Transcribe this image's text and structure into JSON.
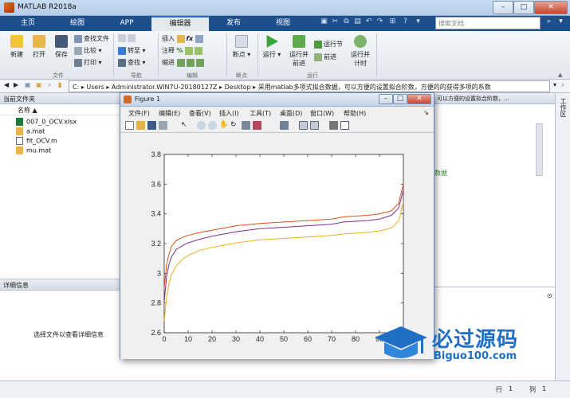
{
  "window": {
    "title": "MATLAB R2018a"
  },
  "tabs": [
    "主页",
    "绘图",
    "APP",
    "编辑器",
    "发布",
    "视图"
  ],
  "search": {
    "placeholder": "搜索文档"
  },
  "ribbon": {
    "file": {
      "new": "新建",
      "open": "打开",
      "save": "保存",
      "find_files": "查找文件",
      "compare": "比较",
      "print": "打印",
      "group": "文件"
    },
    "navigate": {
      "goto": "转至",
      "find": "查找",
      "group": "导航"
    },
    "edit": {
      "insert": "插入",
      "comment": "注释",
      "indent": "缩进",
      "group": "编辑"
    },
    "breakpoints": {
      "label": "断点",
      "group": "断点"
    },
    "run": {
      "run": "运行",
      "run_advance_1": "运行并",
      "run_advance_2": "前进",
      "run_section": "运行节",
      "advance": "前进",
      "run_time_1": "运行并",
      "run_time_2": "计时",
      "group": "运行"
    }
  },
  "address": {
    "path": "C: ▸ Users ▸ Administrator.WIN7U-20180127Z ▸ Desktop ▸ 采用matlab多项式拟合数据，可以方便的设置拟合阶数，方便的的获得多项的系数"
  },
  "current_folder": {
    "title": "当前文件夹",
    "col_name": "名称 ▲",
    "files": [
      "007_0_OCV.xlsx",
      "a.mat",
      "fit_OCV.m",
      "mu.mat"
    ]
  },
  "details": {
    "title": "详细信息",
    "message": "选择文件以查看详细信息"
  },
  "editor_fragments": {
    "tab_text": "可以方便的设置拟合阶数，...",
    "code_text": "数据"
  },
  "side_label": "工作区",
  "status": {
    "row_label": "行",
    "row_val": "1",
    "col_label": "列",
    "col_val": "1"
  },
  "figure": {
    "title": "Figure 1",
    "menu": [
      "文件(F)",
      "编辑(E)",
      "查看(V)",
      "插入(I)",
      "工具(T)",
      "桌面(D)",
      "窗口(W)",
      "帮助(H)"
    ]
  },
  "watermark": {
    "main": "必过源码",
    "sub": "Biguo100.com"
  },
  "chart_data": {
    "type": "line",
    "xlim": [
      0,
      100
    ],
    "ylim": [
      2.6,
      3.8
    ],
    "xticks": [
      0,
      10,
      20,
      30,
      40,
      50,
      60,
      70,
      80,
      90
    ],
    "yticks": [
      2.6,
      2.8,
      3,
      3.2,
      3.4,
      3.6,
      3.8
    ],
    "grid": false,
    "x": [
      0,
      1,
      2,
      3,
      5,
      8,
      10,
      15,
      20,
      30,
      40,
      50,
      60,
      70,
      75,
      80,
      85,
      90,
      95,
      98,
      100
    ],
    "series": [
      {
        "color": "#d95319",
        "values": [
          2.9,
          3.06,
          3.13,
          3.18,
          3.22,
          3.245,
          3.255,
          3.275,
          3.29,
          3.32,
          3.335,
          3.345,
          3.355,
          3.365,
          3.38,
          3.385,
          3.39,
          3.4,
          3.42,
          3.47,
          3.6
        ]
      },
      {
        "color": "#7e2f8e",
        "values": [
          2.81,
          2.98,
          3.06,
          3.11,
          3.16,
          3.19,
          3.205,
          3.23,
          3.25,
          3.28,
          3.3,
          3.31,
          3.32,
          3.33,
          3.345,
          3.35,
          3.355,
          3.365,
          3.39,
          3.44,
          3.56
        ]
      },
      {
        "color": "#edb120",
        "values": [
          2.68,
          2.84,
          2.93,
          2.99,
          3.05,
          3.1,
          3.12,
          3.155,
          3.175,
          3.205,
          3.225,
          3.235,
          3.245,
          3.255,
          3.265,
          3.27,
          3.275,
          3.285,
          3.305,
          3.35,
          3.48
        ]
      }
    ]
  }
}
